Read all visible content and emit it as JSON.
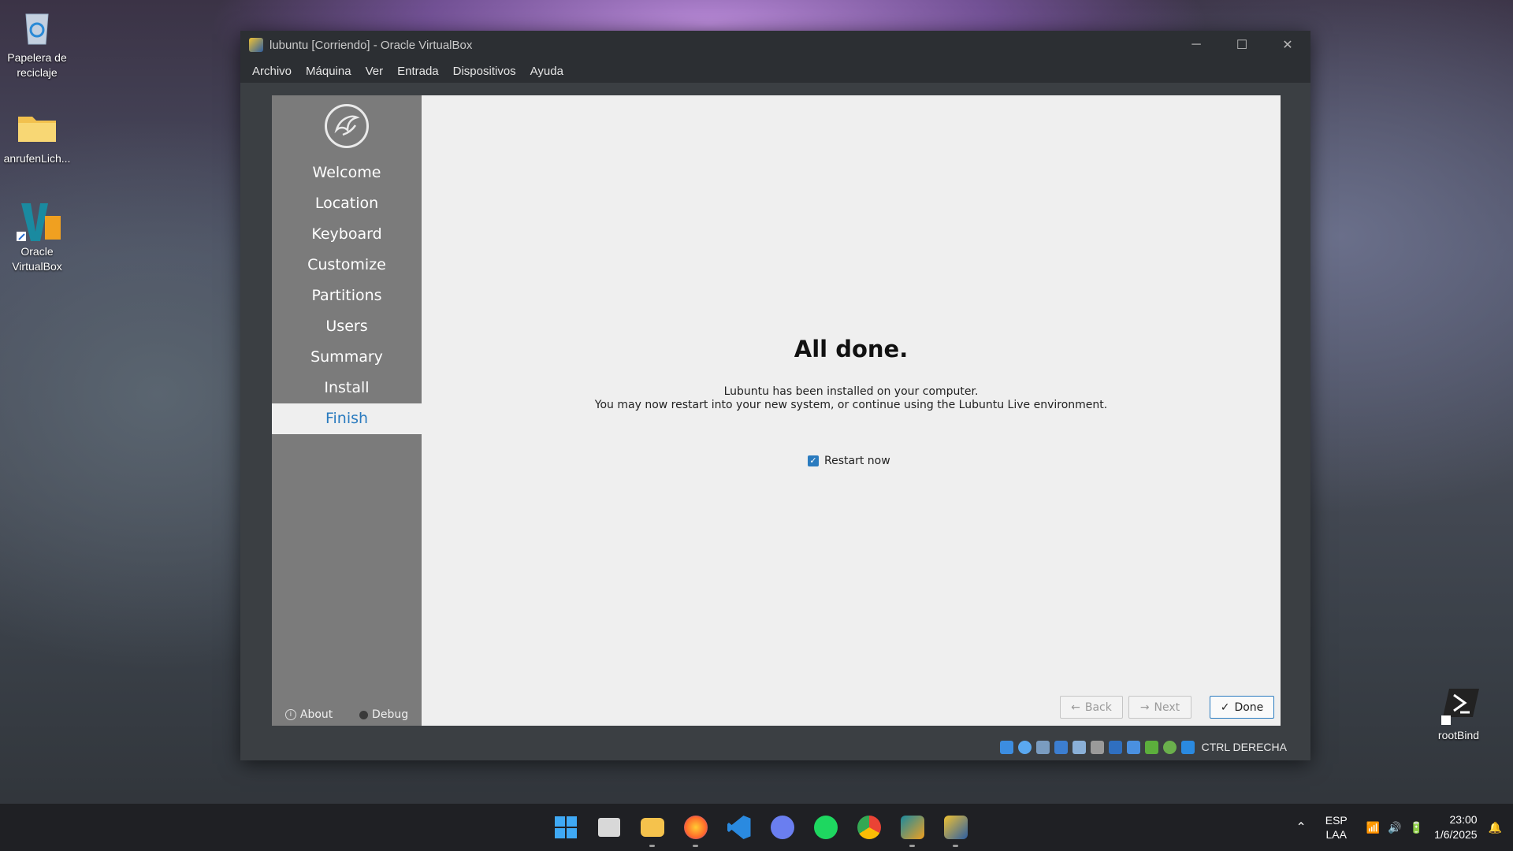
{
  "desktop": {
    "icons": [
      {
        "label": "Papelera de reciclaje",
        "icon": "recycle-bin-icon"
      },
      {
        "label": "anrufenLich...",
        "icon": "folder-icon"
      },
      {
        "label": "Oracle VirtualBox",
        "icon": "virtualbox-icon"
      },
      {
        "label": "rootBind",
        "icon": "terminal-shortcut-icon"
      }
    ]
  },
  "window": {
    "title": "lubuntu [Corriendo] - Oracle VirtualBox",
    "controls": {
      "minimize": "─",
      "maximize": "☐",
      "close": "✕"
    },
    "menu": [
      "Archivo",
      "Máquina",
      "Ver",
      "Entrada",
      "Dispositivos",
      "Ayuda"
    ],
    "host_key": "CTRL DERECHA",
    "status_icons": [
      "hard-disk-icon",
      "optical-drive-icon",
      "audio-icon",
      "network-icon",
      "usb-icon",
      "shared-folder-icon",
      "display-icon",
      "recording-icon",
      "cpu-icon",
      "mouse-integration-icon",
      "download-icon"
    ]
  },
  "installer": {
    "steps": [
      "Welcome",
      "Location",
      "Keyboard",
      "Customize",
      "Partitions",
      "Users",
      "Summary",
      "Install",
      "Finish"
    ],
    "active_step": "Finish",
    "about": "About",
    "debug": "Debug",
    "heading": "All done.",
    "line1": "Lubuntu has been installed on your computer.",
    "line2": "You may now restart into your new system, or continue using the Lubuntu Live environment.",
    "restart_label": "Restart now",
    "restart_checked": true,
    "back_label": "Back",
    "next_label": "Next",
    "done_label": "Done",
    "accent": "#2a7bbf"
  },
  "taskbar": {
    "apps": [
      "start-icon",
      "task-view-icon",
      "file-explorer-icon",
      "firefox-icon",
      "vscode-icon",
      "discord-icon",
      "spotify-icon",
      "chrome-icon",
      "virtualbox-icon",
      "virtualbox-vm-icon"
    ],
    "lang_top": "ESP",
    "lang_bottom": "LAA",
    "time": "23:00",
    "date": "1/6/2025"
  }
}
